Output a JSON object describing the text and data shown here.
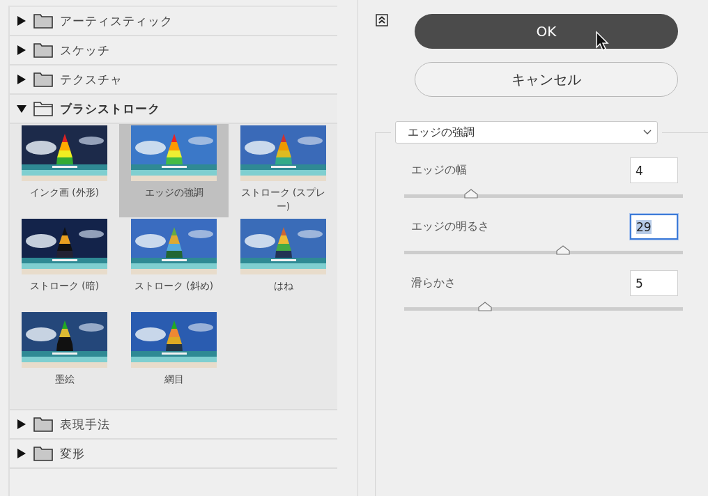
{
  "categories": [
    {
      "label": "アーティスティック",
      "expanded": false
    },
    {
      "label": "スケッチ",
      "expanded": false
    },
    {
      "label": "テクスチャ",
      "expanded": false
    },
    {
      "label": "ブラシストローク",
      "expanded": true,
      "filters": [
        {
          "label": "インク画 (外形)",
          "selected": false
        },
        {
          "label": "エッジの強調",
          "selected": true
        },
        {
          "label": "ストローク (スプレー)",
          "selected": false
        },
        {
          "label": "ストローク (暗)",
          "selected": false
        },
        {
          "label": "ストローク (斜め)",
          "selected": false
        },
        {
          "label": "はね",
          "selected": false
        },
        {
          "label": "墨絵",
          "selected": false
        },
        {
          "label": "網目",
          "selected": false
        }
      ]
    },
    {
      "label": "表現手法",
      "expanded": false
    },
    {
      "label": "変形",
      "expanded": false
    }
  ],
  "buttons": [
    {
      "label": "OK",
      "kind": "primary"
    },
    {
      "label": "キャンセル",
      "kind": "secondary"
    }
  ],
  "filter_select": {
    "value": "エッジの強調"
  },
  "settings": [
    {
      "label": "エッジの幅",
      "value": "4",
      "text_selected": false,
      "level": 0.24
    },
    {
      "label": "エッジの明るさ",
      "value": "29",
      "text_selected": true,
      "level": 0.57
    },
    {
      "label": "滑らかさ",
      "value": "5",
      "text_selected": false,
      "level": 0.29
    }
  ]
}
